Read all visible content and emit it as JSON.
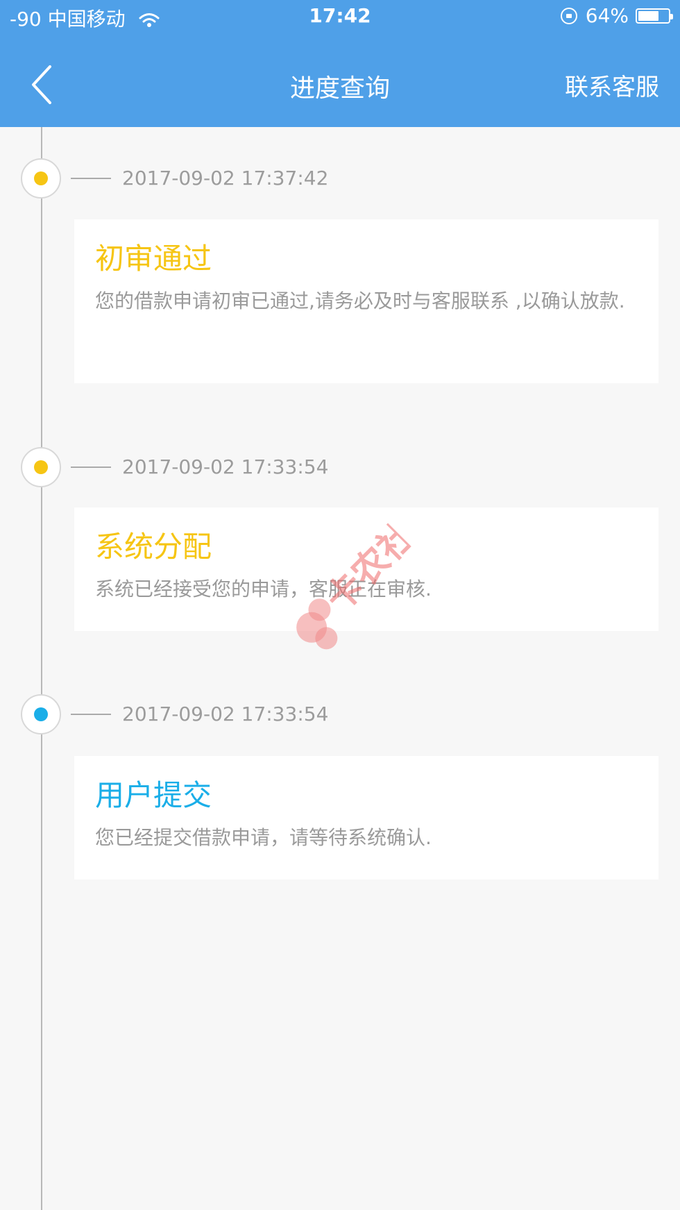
{
  "status_bar": {
    "signal_carrier": "-90 中国移动",
    "time": "17:42",
    "battery": "64%"
  },
  "nav": {
    "title": "进度查询",
    "contact_label": "联系客服"
  },
  "timeline": [
    {
      "time": "2017-09-02 17:37:42",
      "title": "初审通过",
      "desc": "您的借款申请初审已通过,请务必及时与客服联系 ,以确认放款.",
      "color": "#f6c514"
    },
    {
      "time": "2017-09-02 17:33:54",
      "title": "系统分配",
      "desc": "系统已经接受您的申请，客服正在审核.",
      "color": "#f6c514"
    },
    {
      "time": "2017-09-02 17:33:54",
      "title": "用户提交",
      "desc": "您已经提交借款申请，请等待系统确认.",
      "color": "#1aaee8"
    }
  ],
  "watermark": {
    "text": "卡农社区"
  },
  "colors": {
    "header_bg": "#4fa0e8",
    "pending": "#f6c514",
    "submitted": "#1aaee8"
  }
}
